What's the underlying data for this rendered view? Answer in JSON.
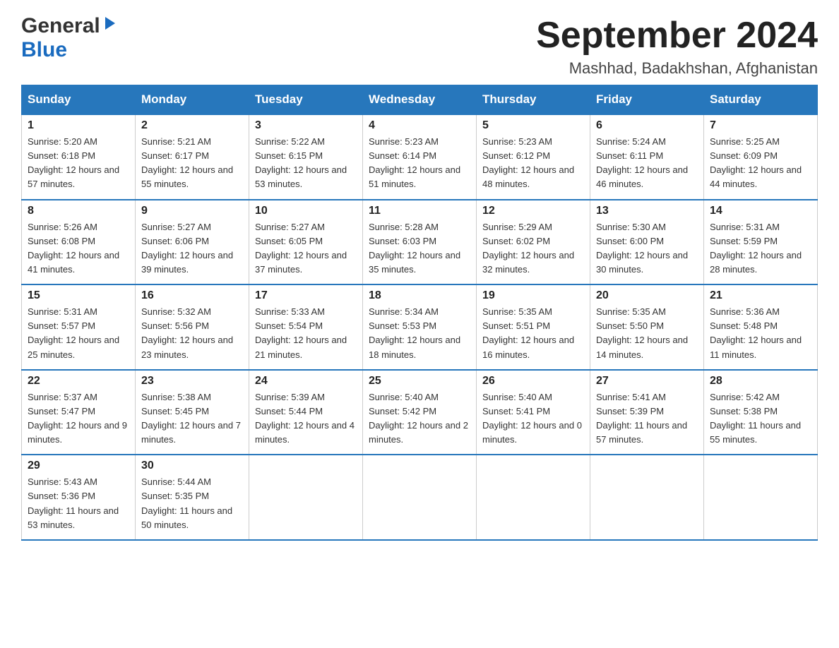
{
  "logo": {
    "general": "General",
    "blue": "Blue"
  },
  "header": {
    "title": "September 2024",
    "subtitle": "Mashhad, Badakhshan, Afghanistan"
  },
  "columns": [
    "Sunday",
    "Monday",
    "Tuesday",
    "Wednesday",
    "Thursday",
    "Friday",
    "Saturday"
  ],
  "weeks": [
    [
      {
        "day": "1",
        "sunrise": "Sunrise: 5:20 AM",
        "sunset": "Sunset: 6:18 PM",
        "daylight": "Daylight: 12 hours and 57 minutes."
      },
      {
        "day": "2",
        "sunrise": "Sunrise: 5:21 AM",
        "sunset": "Sunset: 6:17 PM",
        "daylight": "Daylight: 12 hours and 55 minutes."
      },
      {
        "day": "3",
        "sunrise": "Sunrise: 5:22 AM",
        "sunset": "Sunset: 6:15 PM",
        "daylight": "Daylight: 12 hours and 53 minutes."
      },
      {
        "day": "4",
        "sunrise": "Sunrise: 5:23 AM",
        "sunset": "Sunset: 6:14 PM",
        "daylight": "Daylight: 12 hours and 51 minutes."
      },
      {
        "day": "5",
        "sunrise": "Sunrise: 5:23 AM",
        "sunset": "Sunset: 6:12 PM",
        "daylight": "Daylight: 12 hours and 48 minutes."
      },
      {
        "day": "6",
        "sunrise": "Sunrise: 5:24 AM",
        "sunset": "Sunset: 6:11 PM",
        "daylight": "Daylight: 12 hours and 46 minutes."
      },
      {
        "day": "7",
        "sunrise": "Sunrise: 5:25 AM",
        "sunset": "Sunset: 6:09 PM",
        "daylight": "Daylight: 12 hours and 44 minutes."
      }
    ],
    [
      {
        "day": "8",
        "sunrise": "Sunrise: 5:26 AM",
        "sunset": "Sunset: 6:08 PM",
        "daylight": "Daylight: 12 hours and 41 minutes."
      },
      {
        "day": "9",
        "sunrise": "Sunrise: 5:27 AM",
        "sunset": "Sunset: 6:06 PM",
        "daylight": "Daylight: 12 hours and 39 minutes."
      },
      {
        "day": "10",
        "sunrise": "Sunrise: 5:27 AM",
        "sunset": "Sunset: 6:05 PM",
        "daylight": "Daylight: 12 hours and 37 minutes."
      },
      {
        "day": "11",
        "sunrise": "Sunrise: 5:28 AM",
        "sunset": "Sunset: 6:03 PM",
        "daylight": "Daylight: 12 hours and 35 minutes."
      },
      {
        "day": "12",
        "sunrise": "Sunrise: 5:29 AM",
        "sunset": "Sunset: 6:02 PM",
        "daylight": "Daylight: 12 hours and 32 minutes."
      },
      {
        "day": "13",
        "sunrise": "Sunrise: 5:30 AM",
        "sunset": "Sunset: 6:00 PM",
        "daylight": "Daylight: 12 hours and 30 minutes."
      },
      {
        "day": "14",
        "sunrise": "Sunrise: 5:31 AM",
        "sunset": "Sunset: 5:59 PM",
        "daylight": "Daylight: 12 hours and 28 minutes."
      }
    ],
    [
      {
        "day": "15",
        "sunrise": "Sunrise: 5:31 AM",
        "sunset": "Sunset: 5:57 PM",
        "daylight": "Daylight: 12 hours and 25 minutes."
      },
      {
        "day": "16",
        "sunrise": "Sunrise: 5:32 AM",
        "sunset": "Sunset: 5:56 PM",
        "daylight": "Daylight: 12 hours and 23 minutes."
      },
      {
        "day": "17",
        "sunrise": "Sunrise: 5:33 AM",
        "sunset": "Sunset: 5:54 PM",
        "daylight": "Daylight: 12 hours and 21 minutes."
      },
      {
        "day": "18",
        "sunrise": "Sunrise: 5:34 AM",
        "sunset": "Sunset: 5:53 PM",
        "daylight": "Daylight: 12 hours and 18 minutes."
      },
      {
        "day": "19",
        "sunrise": "Sunrise: 5:35 AM",
        "sunset": "Sunset: 5:51 PM",
        "daylight": "Daylight: 12 hours and 16 minutes."
      },
      {
        "day": "20",
        "sunrise": "Sunrise: 5:35 AM",
        "sunset": "Sunset: 5:50 PM",
        "daylight": "Daylight: 12 hours and 14 minutes."
      },
      {
        "day": "21",
        "sunrise": "Sunrise: 5:36 AM",
        "sunset": "Sunset: 5:48 PM",
        "daylight": "Daylight: 12 hours and 11 minutes."
      }
    ],
    [
      {
        "day": "22",
        "sunrise": "Sunrise: 5:37 AM",
        "sunset": "Sunset: 5:47 PM",
        "daylight": "Daylight: 12 hours and 9 minutes."
      },
      {
        "day": "23",
        "sunrise": "Sunrise: 5:38 AM",
        "sunset": "Sunset: 5:45 PM",
        "daylight": "Daylight: 12 hours and 7 minutes."
      },
      {
        "day": "24",
        "sunrise": "Sunrise: 5:39 AM",
        "sunset": "Sunset: 5:44 PM",
        "daylight": "Daylight: 12 hours and 4 minutes."
      },
      {
        "day": "25",
        "sunrise": "Sunrise: 5:40 AM",
        "sunset": "Sunset: 5:42 PM",
        "daylight": "Daylight: 12 hours and 2 minutes."
      },
      {
        "day": "26",
        "sunrise": "Sunrise: 5:40 AM",
        "sunset": "Sunset: 5:41 PM",
        "daylight": "Daylight: 12 hours and 0 minutes."
      },
      {
        "day": "27",
        "sunrise": "Sunrise: 5:41 AM",
        "sunset": "Sunset: 5:39 PM",
        "daylight": "Daylight: 11 hours and 57 minutes."
      },
      {
        "day": "28",
        "sunrise": "Sunrise: 5:42 AM",
        "sunset": "Sunset: 5:38 PM",
        "daylight": "Daylight: 11 hours and 55 minutes."
      }
    ],
    [
      {
        "day": "29",
        "sunrise": "Sunrise: 5:43 AM",
        "sunset": "Sunset: 5:36 PM",
        "daylight": "Daylight: 11 hours and 53 minutes."
      },
      {
        "day": "30",
        "sunrise": "Sunrise: 5:44 AM",
        "sunset": "Sunset: 5:35 PM",
        "daylight": "Daylight: 11 hours and 50 minutes."
      },
      null,
      null,
      null,
      null,
      null
    ]
  ]
}
